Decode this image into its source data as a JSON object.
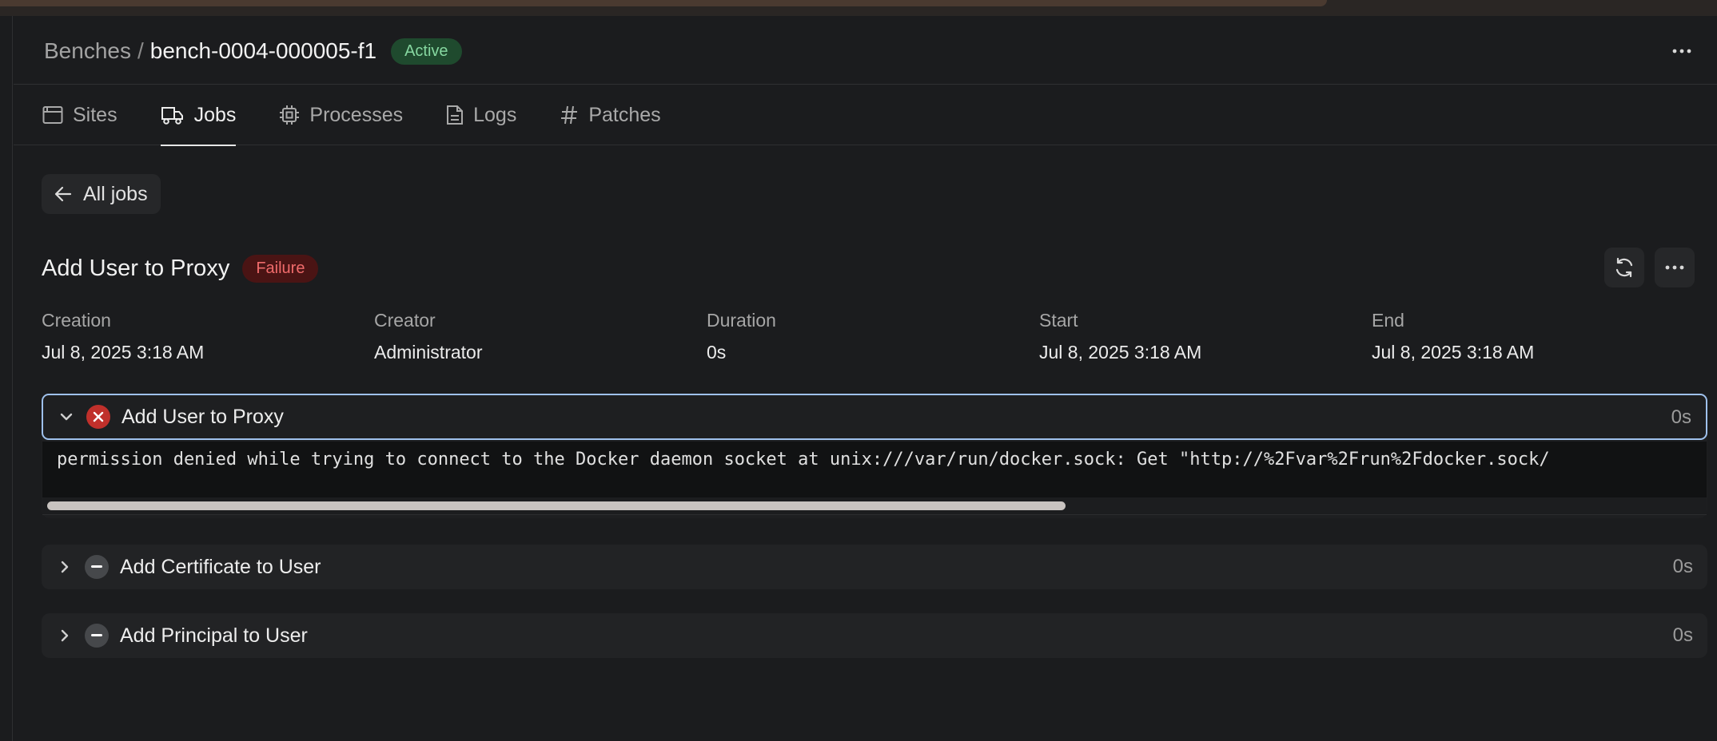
{
  "header": {
    "breadcrumb_parent": "Benches",
    "breadcrumb_separator": "/",
    "breadcrumb_current": "bench-0004-000005-f1",
    "status_badge": "Active",
    "menu_icon": "more-horizontal-icon"
  },
  "tabs": [
    {
      "label": "Sites",
      "icon": "browser-window-icon",
      "active": false
    },
    {
      "label": "Jobs",
      "icon": "truck-icon",
      "active": true
    },
    {
      "label": "Processes",
      "icon": "cpu-icon",
      "active": false
    },
    {
      "label": "Logs",
      "icon": "file-text-icon",
      "active": false
    },
    {
      "label": "Patches",
      "icon": "hash-icon",
      "active": false
    }
  ],
  "back_button": {
    "label": "All jobs",
    "icon": "arrow-left-icon"
  },
  "job": {
    "title": "Add User to Proxy",
    "status_badge": "Failure",
    "refresh_icon": "refresh-icon",
    "menu_icon": "more-horizontal-icon",
    "meta": [
      {
        "label": "Creation",
        "value": "Jul 8, 2025 3:18 AM"
      },
      {
        "label": "Creator",
        "value": "Administrator"
      },
      {
        "label": "Duration",
        "value": "0s"
      },
      {
        "label": "Start",
        "value": "Jul 8, 2025 3:18 AM"
      },
      {
        "label": "End",
        "value": "Jul 8, 2025 3:18 AM"
      }
    ]
  },
  "steps": [
    {
      "name": "Add User to Proxy",
      "duration": "0s",
      "status": "failure",
      "expanded": true,
      "output": "permission denied while trying to connect to the Docker daemon socket at unix:///var/run/docker.sock: Get \"http://%2Fvar%2Frun%2Fdocker.sock/"
    },
    {
      "name": "Add Certificate to User",
      "duration": "0s",
      "status": "skipped",
      "expanded": false
    },
    {
      "name": "Add Principal to User",
      "duration": "0s",
      "status": "skipped",
      "expanded": false
    }
  ],
  "colors": {
    "background": "#1b1c1e",
    "active_badge_bg": "#1f4a2e",
    "active_badge_text": "#86d7a0",
    "failure_badge_bg": "#4a1414",
    "failure_badge_text": "#ef6b6b",
    "failure_icon": "#c0302b",
    "focus_ring": "#9fc1ec"
  }
}
